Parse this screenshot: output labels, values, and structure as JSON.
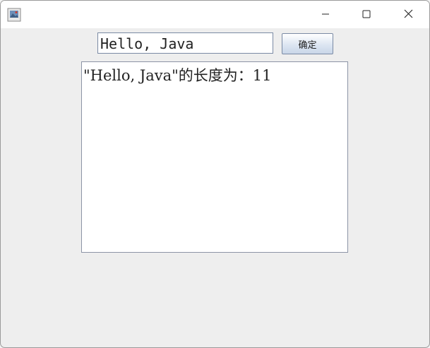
{
  "window": {
    "title": "",
    "controls": {
      "minimize_icon": "minimize-icon",
      "maximize_icon": "maximize-icon",
      "close_icon": "close-icon"
    }
  },
  "form": {
    "input_value": "Hello, Java",
    "ok_label": "确定"
  },
  "output": {
    "text": "\"Hello, Java\"的长度为：11"
  },
  "colors": {
    "window_bg": "#eeeeee",
    "titlebar_bg": "#ffffff",
    "field_border": "#7a8aa4"
  }
}
